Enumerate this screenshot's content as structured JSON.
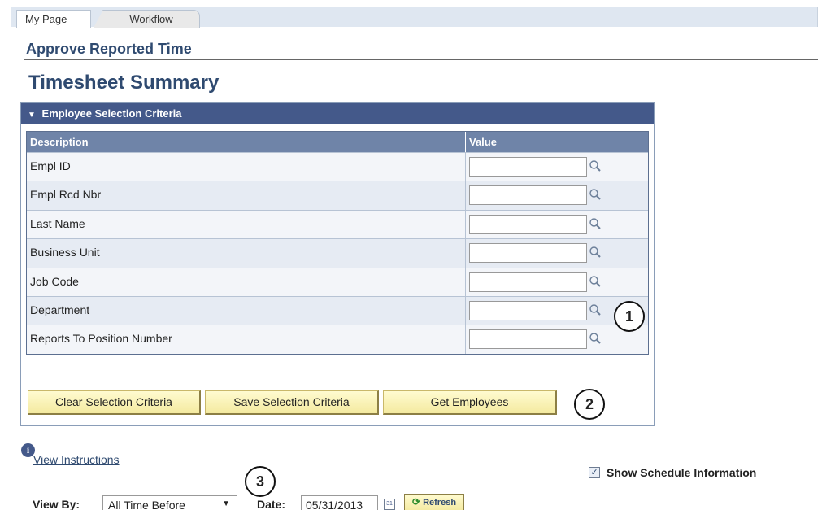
{
  "tabs": [
    {
      "label": "My Page"
    },
    {
      "label": "Workflow"
    }
  ],
  "page_title": "Approve Reported Time",
  "summary_title": "Timesheet Summary",
  "criteria": {
    "header": "Employee Selection Criteria",
    "columns": {
      "description": "Description",
      "value": "Value"
    },
    "rows": [
      {
        "label": "Empl ID",
        "value": ""
      },
      {
        "label": "Empl Rcd Nbr",
        "value": ""
      },
      {
        "label": "Last Name",
        "value": ""
      },
      {
        "label": "Business Unit",
        "value": ""
      },
      {
        "label": "Job Code",
        "value": ""
      },
      {
        "label": "Department",
        "value": ""
      },
      {
        "label": "Reports To Position Number",
        "value": ""
      }
    ]
  },
  "buttons": {
    "clear": "Clear Selection Criteria",
    "save": "Save Selection Criteria",
    "get": "Get Employees"
  },
  "callouts": [
    "1",
    "2",
    "3"
  ],
  "view_instructions": "View Instructions",
  "show_schedule": {
    "label": "Show Schedule Information",
    "checked": true
  },
  "filters": {
    "view_by_label": "View By:",
    "view_by_value": "All Time Before",
    "date_label": "Date:",
    "date_value": "05/31/2013",
    "refresh_label": "Refresh"
  },
  "icons": {
    "lookup": "magnifier-icon",
    "info": "info-icon",
    "calendar": "calendar-icon",
    "refresh": "refresh-icon"
  }
}
